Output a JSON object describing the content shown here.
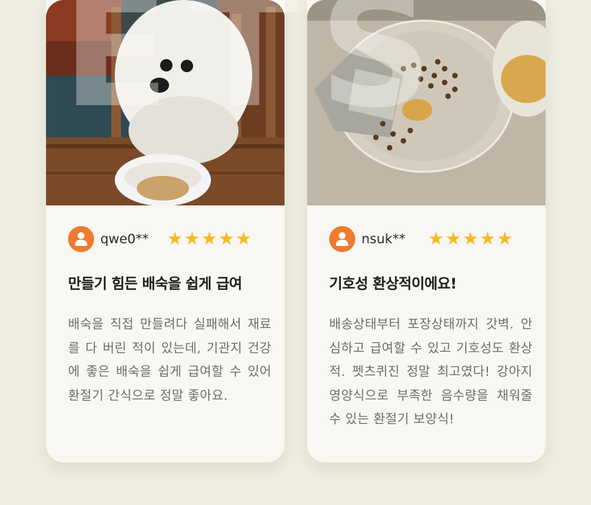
{
  "watermark": "ETS",
  "reviews": [
    {
      "photo_icon": "dog-photo",
      "username": "qwe0**",
      "rating": 5,
      "stars": "★★★★★",
      "title": "만들기 힘든 배숙을 쉽게 급여",
      "body": "배숙을 직접 만들려다 실패해서 재료를 다 버린 적이 있는데, 기관지 건강에 좋은 배숙을 쉽게 급여할 수 있어 환절기 간식으로 정말 좋아요."
    },
    {
      "photo_icon": "food-bowl-photo",
      "username": "nsuk**",
      "rating": 5,
      "stars": "★★★★★",
      "title": "기호성 환상적이에요!",
      "body": "배송상태부터 포장상태까지 갓벽. 안심하고 급여할 수 있고 기호성도 환상적. 펫츠퀴진 정말 최고였다! 강아지 영양식으로 부족한 음수량을 채워줄 수 있는 환절기 보양식!"
    }
  ],
  "colors": {
    "background": "#efede1",
    "card": "#f8f7f3",
    "avatar": "#ef7b2e",
    "star": "#f6b824"
  }
}
